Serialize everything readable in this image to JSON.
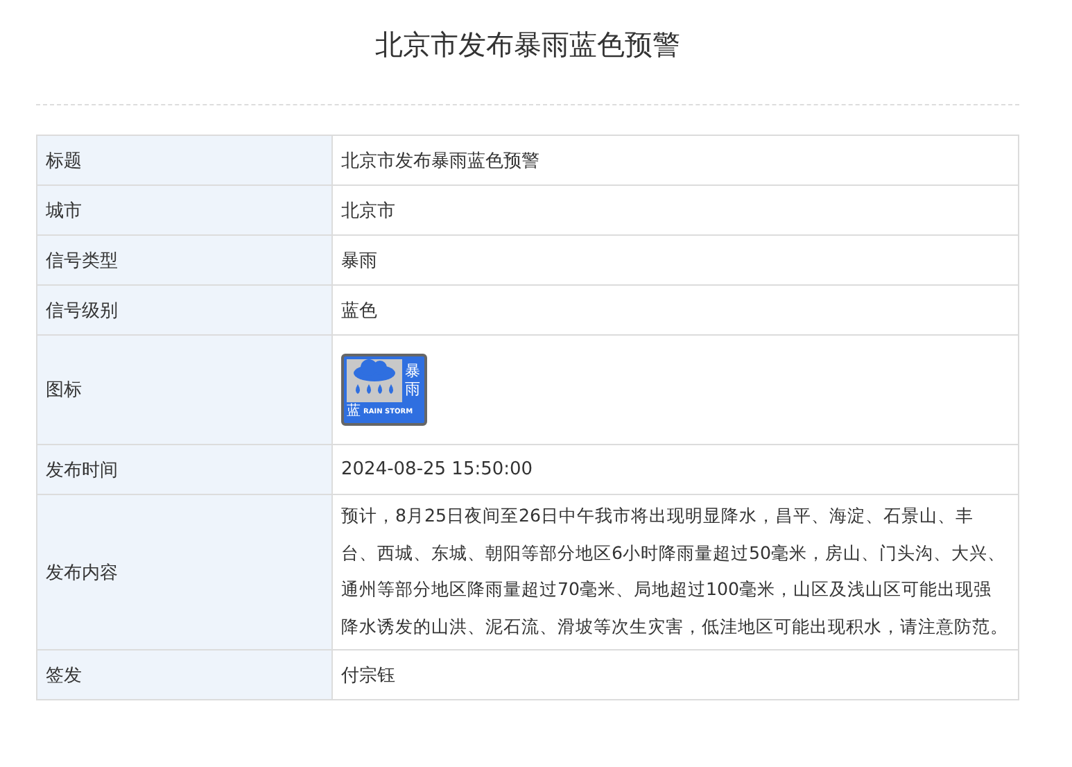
{
  "page": {
    "title": "北京市发布暴雨蓝色预警"
  },
  "rows": [
    {
      "kind": "text",
      "label": "标题",
      "value": "北京市发布暴雨蓝色预警"
    },
    {
      "kind": "text",
      "label": "城市",
      "value": "北京市"
    },
    {
      "kind": "text",
      "label": "信号类型",
      "value": "暴雨"
    },
    {
      "kind": "text",
      "label": "信号级别",
      "value": "蓝色"
    },
    {
      "kind": "icon",
      "label": "图标",
      "icon": {
        "title": "暴雨",
        "level": "蓝",
        "english": "RAIN STORM",
        "color": "#2f6fe0"
      }
    },
    {
      "kind": "text",
      "label": "发布时间",
      "value": "2024-08-25 15:50:00"
    },
    {
      "kind": "paragraph",
      "label": "发布内容",
      "value": "预计，8月25日夜间至26日中午我市将出现明显降水，昌平、海淀、石景山、丰台、西城、东城、朝阳等部分地区6小时降雨量超过50毫米，房山、门头沟、大兴、通州等部分地区降雨量超过70毫米、局地超过100毫米，山区及浅山区可能出现强降水诱发的山洪、泥石流、滑坡等次生灾害，低洼地区可能出现积水，请注意防范。"
    },
    {
      "kind": "text",
      "label": "签发",
      "value": "付宗钰"
    }
  ]
}
